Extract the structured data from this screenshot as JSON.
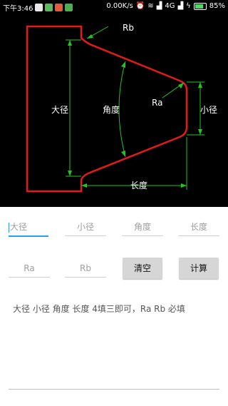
{
  "status_bar": {
    "time": "下午3:46",
    "speed": "0.00K/s",
    "network": "4G",
    "battery": "85%"
  },
  "diagram": {
    "labels": {
      "rb": "Rb",
      "ra": "Ra",
      "big_diameter": "大径",
      "small_diameter": "小径",
      "angle": "角度",
      "length": "长度"
    },
    "colors": {
      "outline": "#e01b1b",
      "dimension": "#22c422",
      "background": "#000000"
    }
  },
  "inputs": {
    "big_diameter": {
      "placeholder": "大径"
    },
    "small_diameter": {
      "placeholder": "小径"
    },
    "angle": {
      "placeholder": "角度"
    },
    "length": {
      "placeholder": "长度"
    },
    "ra": {
      "placeholder": "Ra"
    },
    "rb": {
      "placeholder": "Rb"
    }
  },
  "buttons": {
    "clear": "清空",
    "calculate": "计算"
  },
  "hint": "大径 小径 角度 长度 4填三即可，Ra Rb 必填"
}
